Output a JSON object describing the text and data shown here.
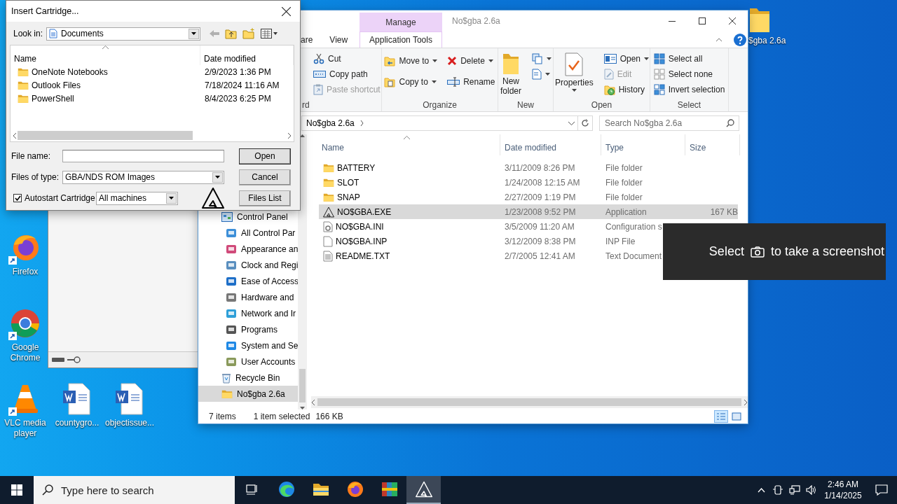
{
  "desktop": {
    "icons": [
      {
        "label": "Firefox"
      },
      {
        "label": "Google Chrome"
      },
      {
        "label": "VLC media player"
      },
      {
        "label": "countygro..."
      },
      {
        "label": "objectissue..."
      },
      {
        "label": "$gba 2.6a"
      }
    ]
  },
  "back_window": {
    "kind": "window"
  },
  "explorer": {
    "title": "No$gba 2.6a",
    "context_tab": "Manage",
    "tabs": [
      {
        "kind": "normal",
        "label": "are"
      },
      {
        "kind": "normal",
        "label": "View"
      },
      {
        "kind": "contextual",
        "label": "Application Tools"
      }
    ],
    "ribbon": [
      {
        "label": "rd",
        "items": [
          {
            "kind": "small",
            "label": "Cut",
            "dropdown": false,
            "disabled": false
          },
          {
            "kind": "small",
            "label": "Copy path",
            "dropdown": false,
            "disabled": false
          },
          {
            "kind": "small",
            "label": "Paste shortcut",
            "dropdown": false,
            "disabled": true
          }
        ]
      },
      {
        "label": "Organize",
        "items": [
          {
            "kind": "small",
            "label": "Move to",
            "dropdown": true,
            "disabled": false
          },
          {
            "kind": "small",
            "label": "Copy to",
            "dropdown": true,
            "disabled": false
          },
          {
            "kind": "small",
            "label": "Delete",
            "dropdown": true,
            "disabled": false
          },
          {
            "kind": "small",
            "label": "Rename",
            "dropdown": false,
            "disabled": false
          }
        ]
      },
      {
        "label": "New",
        "items": [
          {
            "kind": "large",
            "label": "New folder",
            "dropdown": false,
            "disabled": false
          },
          {
            "kind": "icon",
            "dropdown": true,
            "disabled": false
          },
          {
            "kind": "icon",
            "dropdown": true,
            "disabled": false
          }
        ]
      },
      {
        "label": "Open",
        "items": [
          {
            "kind": "large",
            "label": "Properties",
            "dropdown": true,
            "disabled": false
          },
          {
            "kind": "small",
            "label": "Open",
            "dropdown": true,
            "disabled": false
          },
          {
            "kind": "small",
            "label": "Edit",
            "dropdown": false,
            "disabled": true
          },
          {
            "kind": "small",
            "label": "History",
            "dropdown": false,
            "disabled": false
          }
        ]
      },
      {
        "label": "Select",
        "items": [
          {
            "kind": "small",
            "label": "Select all",
            "dropdown": false,
            "disabled": false
          },
          {
            "kind": "small",
            "label": "Select none",
            "dropdown": false,
            "disabled": false
          },
          {
            "kind": "small",
            "label": "Invert selection",
            "dropdown": false,
            "disabled": false
          }
        ]
      }
    ],
    "address": {
      "path": "No$gba 2.6a"
    },
    "search": {
      "placeholder": "Search No$gba 2.6a"
    },
    "nav": [
      {
        "label": "Control Panel",
        "selected": false,
        "children": [
          {
            "label": "All Control Par",
            "selected": false
          },
          {
            "label": "Appearance an",
            "selected": false
          },
          {
            "label": "Clock and Regi",
            "selected": false
          },
          {
            "label": "Ease of Access",
            "selected": false
          },
          {
            "label": "Hardware and",
            "selected": false
          },
          {
            "label": "Network and Ir",
            "selected": false
          },
          {
            "label": "Programs",
            "selected": false
          },
          {
            "label": "System and Se",
            "selected": false
          },
          {
            "label": "User Accounts",
            "selected": false
          }
        ]
      },
      {
        "label": "Recycle Bin",
        "selected": false
      },
      {
        "label": "No$gba 2.6a",
        "selected": true
      }
    ],
    "columns": [
      "Name",
      "Date modified",
      "Type",
      "Size"
    ],
    "files": [
      {
        "kind": "folder",
        "name": "BATTERY",
        "date": "3/11/2009 8:26 PM",
        "type": "File folder",
        "selected": false
      },
      {
        "kind": "folder",
        "name": "SLOT",
        "date": "1/24/2008 12:15 AM",
        "type": "File folder",
        "selected": false
      },
      {
        "kind": "folder",
        "name": "SNAP",
        "date": "2/27/2009 1:19 PM",
        "type": "File folder",
        "selected": false
      },
      {
        "kind": "application",
        "name": "NO$GBA.EXE",
        "date": "1/23/2008 9:52 PM",
        "type": "Application",
        "size": "167 KB",
        "selected": true
      },
      {
        "kind": "settings",
        "name": "NO$GBA.INI",
        "date": "3/5/2009 11:20 AM",
        "type": "Configuration s",
        "selected": false
      },
      {
        "kind": "file",
        "name": "NO$GBA.INP",
        "date": "3/12/2009 8:38 PM",
        "type": "INP File",
        "selected": false
      },
      {
        "kind": "text",
        "name": "README.TXT",
        "date": "2/7/2005 12:41 AM",
        "type": "Text Document",
        "selected": false
      }
    ],
    "status": {
      "count": "7 items",
      "selection": "1 item selected",
      "size": "166 KB"
    }
  },
  "dialog": {
    "title": "Insert Cartridge...",
    "look_in": {
      "label": "Look in:",
      "value": "Documents"
    },
    "columns": [
      "Name",
      "Date modified"
    ],
    "rows": [
      {
        "name": "OneNote Notebooks",
        "date": "2/9/2023 1:36 PM"
      },
      {
        "name": "Outlook Files",
        "date": "7/18/2024 11:16 AM"
      },
      {
        "name": "PowerShell",
        "date": "8/4/2023 6:25 PM"
      }
    ],
    "file_name": {
      "label": "File name:"
    },
    "file_type": {
      "label": "Files of type:",
      "value": "GBA/NDS ROM Images"
    },
    "autostart": {
      "label": "Autostart Cartridge",
      "checked": true
    },
    "machine": {
      "value": "All machines"
    },
    "buttons": [
      "Open",
      "Cancel",
      "Files List"
    ]
  },
  "toast": {
    "before": "Select",
    "after": "to take a screenshot"
  },
  "taskbar": {
    "search_placeholder": "Type here to search",
    "apps": [
      {
        "active": false
      },
      {
        "active": false
      },
      {
        "active": false
      },
      {
        "active": false
      },
      {
        "active": true
      }
    ],
    "time": "2:46 AM",
    "date": "1/14/2025"
  }
}
